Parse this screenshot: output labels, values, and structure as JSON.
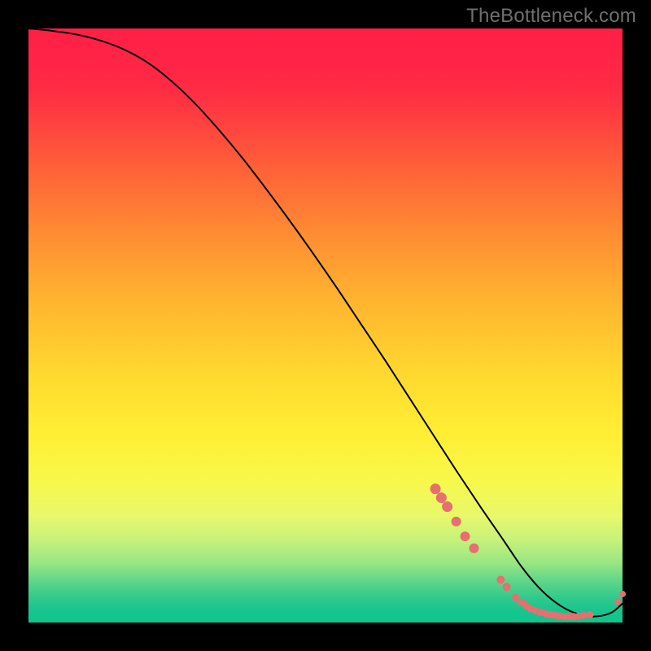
{
  "watermark": "TheBottleneck.com",
  "chart_data": {
    "type": "line",
    "title": "",
    "xlabel": "",
    "ylabel": "",
    "xlim": [
      0,
      100
    ],
    "ylim": [
      0,
      100
    ],
    "grid": false,
    "legend": false,
    "series": [
      {
        "name": "bottleneck-curve",
        "color": "#000000",
        "x": [
          0,
          4,
          8,
          12,
          16,
          20,
          24,
          28,
          32,
          36,
          40,
          44,
          48,
          52,
          56,
          60,
          64,
          68,
          72,
          76,
          80,
          83,
          86,
          89,
          92,
          95,
          98,
          100
        ],
        "y": [
          100,
          99.6,
          99.0,
          98.0,
          96.5,
          94.3,
          91.2,
          87.4,
          83.0,
          78.2,
          73.0,
          67.6,
          62.0,
          56.2,
          50.2,
          44.2,
          38.0,
          31.8,
          25.6,
          19.6,
          13.8,
          9.4,
          5.8,
          3.2,
          1.6,
          1.0,
          1.6,
          3.2
        ]
      }
    ],
    "points": {
      "name": "scatter-points",
      "color": "#e76f6f",
      "radius_default": 5.5,
      "items": [
        {
          "x": 68.5,
          "y": 22.5,
          "r": 6.5
        },
        {
          "x": 69.5,
          "y": 21.0,
          "r": 6.5
        },
        {
          "x": 70.5,
          "y": 19.5,
          "r": 6.5
        },
        {
          "x": 72.0,
          "y": 17.0,
          "r": 6.0
        },
        {
          "x": 73.5,
          "y": 14.5,
          "r": 6.0
        },
        {
          "x": 75.0,
          "y": 12.5,
          "r": 6.0
        },
        {
          "x": 79.5,
          "y": 7.2,
          "r": 5.0
        },
        {
          "x": 80.5,
          "y": 6.0,
          "r": 5.0
        },
        {
          "x": 82.0,
          "y": 4.2,
          "r": 4.5
        },
        {
          "x": 83.0,
          "y": 3.4,
          "r": 4.5
        },
        {
          "x": 83.8,
          "y": 2.8,
          "r": 4.5
        },
        {
          "x": 84.6,
          "y": 2.3,
          "r": 4.5
        },
        {
          "x": 85.4,
          "y": 2.0,
          "r": 4.5
        },
        {
          "x": 86.2,
          "y": 1.7,
          "r": 4.5
        },
        {
          "x": 87.0,
          "y": 1.5,
          "r": 4.5
        },
        {
          "x": 87.8,
          "y": 1.35,
          "r": 4.5
        },
        {
          "x": 88.6,
          "y": 1.2,
          "r": 4.5
        },
        {
          "x": 89.4,
          "y": 1.1,
          "r": 4.5
        },
        {
          "x": 90.2,
          "y": 1.0,
          "r": 4.5
        },
        {
          "x": 91.0,
          "y": 1.0,
          "r": 4.5
        },
        {
          "x": 91.8,
          "y": 1.0,
          "r": 4.5
        },
        {
          "x": 92.6,
          "y": 1.05,
          "r": 4.5
        },
        {
          "x": 93.5,
          "y": 1.2,
          "r": 4.5
        },
        {
          "x": 94.5,
          "y": 1.3,
          "r": 4.5
        },
        {
          "x": 99.2,
          "y": 3.5,
          "r": 4.0
        },
        {
          "x": 100.0,
          "y": 4.8,
          "r": 4.0
        }
      ]
    }
  }
}
